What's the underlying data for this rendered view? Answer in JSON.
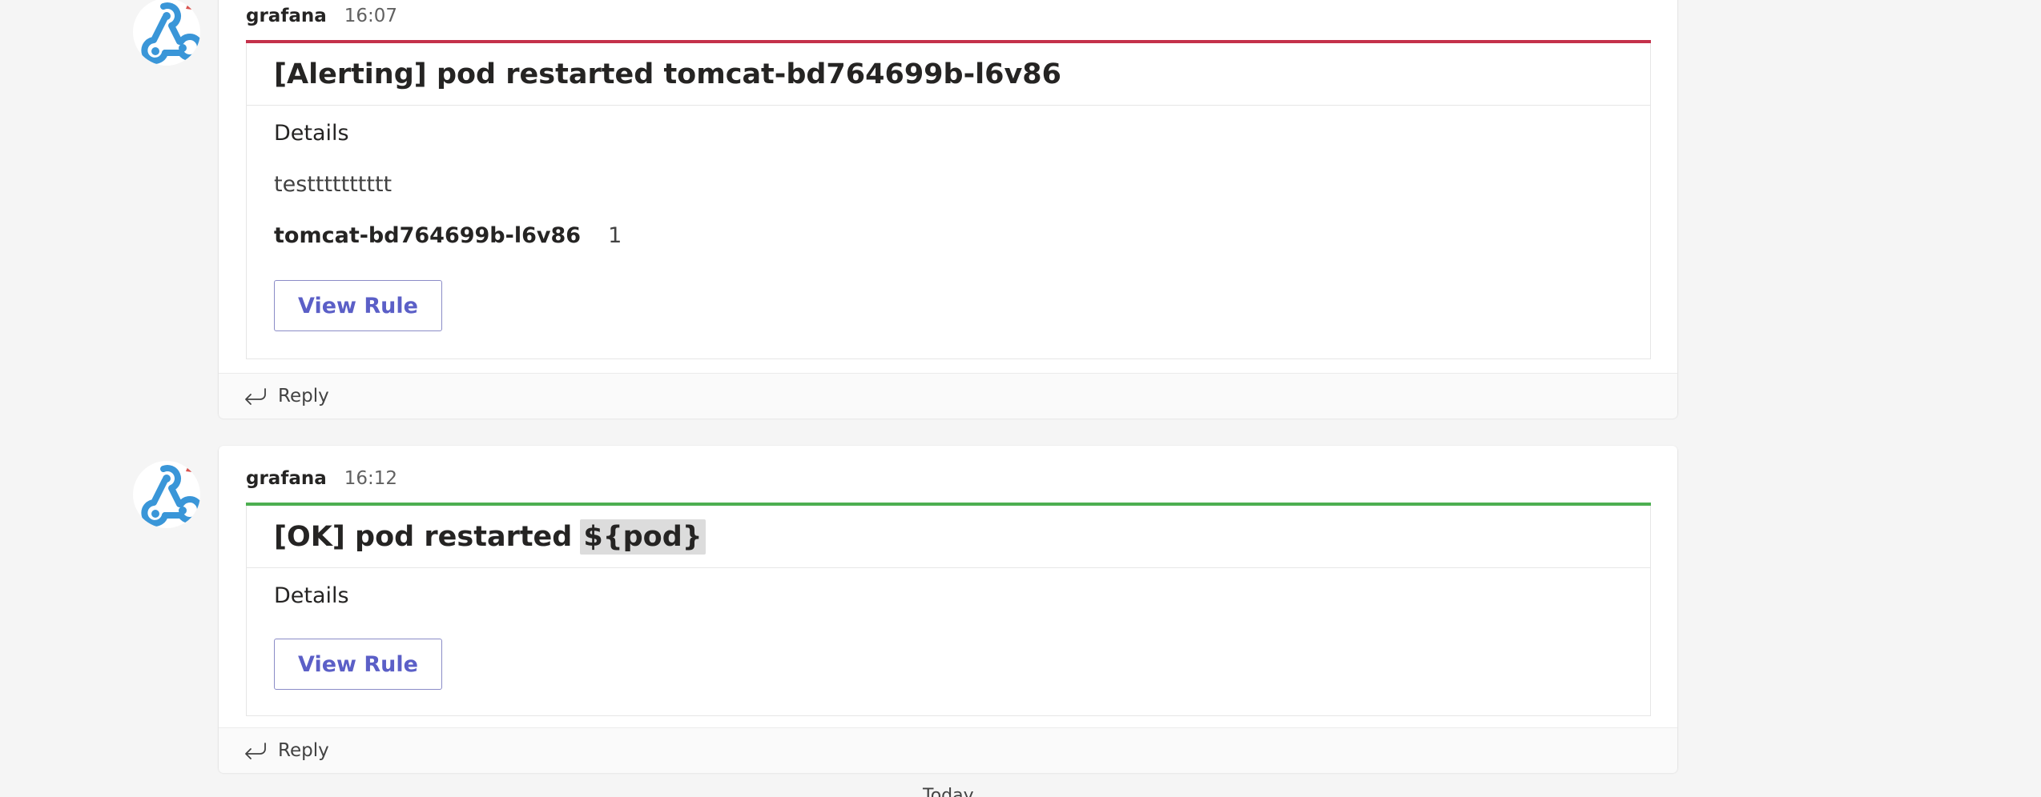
{
  "colors": {
    "alerting": "#c4314b",
    "ok": "#4caf50",
    "button_text": "#5b5fc7",
    "avatar_blue": "#3a96d8"
  },
  "messages": [
    {
      "author": "grafana",
      "time": "16:07",
      "status": "alerting",
      "avatar_icon": "webhook-icon",
      "card": {
        "title": "[Alerting] pod restarted tomcat-bd764699b-l6v86",
        "section_label": "Details",
        "description": "testttttttttt",
        "fact_name": "tomcat-bd764699b-l6v86",
        "fact_value": "1",
        "button_label": "View Rule"
      },
      "reply_label": "Reply",
      "reply_icon": "reply-arrow-icon"
    },
    {
      "author": "grafana",
      "time": "16:12",
      "status": "ok",
      "avatar_icon": "webhook-icon",
      "card": {
        "title_prefix": "[OK] pod restarted",
        "title_placeholder": "${pod}",
        "section_label": "Details",
        "button_label": "View Rule"
      },
      "reply_label": "Reply",
      "reply_icon": "reply-arrow-icon"
    }
  ],
  "bottom_hint": "Today"
}
